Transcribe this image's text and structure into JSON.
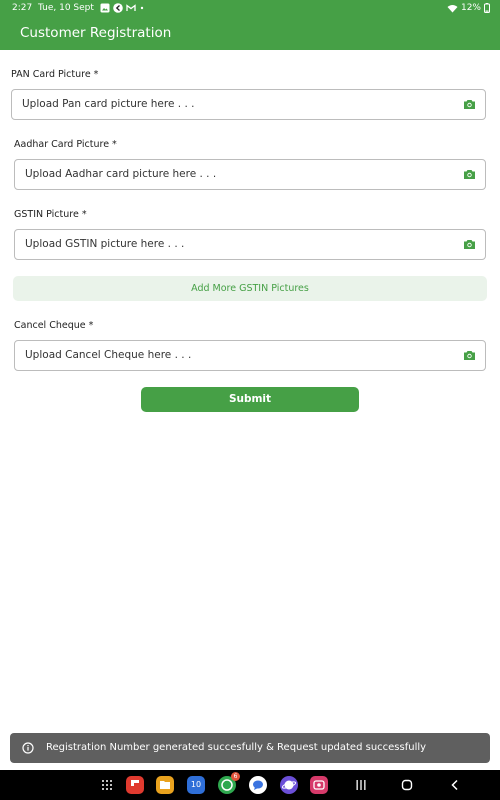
{
  "status_bar": {
    "time": "2:27",
    "date": "Tue, 10 Sept",
    "battery": "12%",
    "icons": [
      "gallery-icon",
      "app-icon",
      "gmail-icon",
      "dot-icon",
      "wifi-icon",
      "battery-icon"
    ]
  },
  "app_bar": {
    "title": "Customer Registration",
    "background": "#46a046"
  },
  "form": {
    "pan": {
      "label": "PAN Card Picture *",
      "placeholder": "Upload Pan card picture here . . ."
    },
    "aadhar": {
      "label": "Aadhar Card Picture *",
      "placeholder": "Upload Aadhar card picture here . . ."
    },
    "gstin": {
      "label": "GSTIN Picture *",
      "placeholder": "Upload GSTIN picture here . . ."
    },
    "add_more_gstin": "Add More GSTIN Pictures",
    "cheque": {
      "label": "Cancel Cheque *",
      "placeholder": "Upload Cancel Cheque here . . ."
    },
    "submit": "Submit"
  },
  "snackbar": {
    "message": "Registration Number generated succesfully & Request updated successfully",
    "icon": "info-icon"
  },
  "nav_bar": {
    "dock_icons": [
      "apps-grid-icon",
      "flipboard-icon",
      "files-icon",
      "calendar-icon",
      "business-chat-icon",
      "messages-icon",
      "internet-icon",
      "screen-recorder-icon"
    ],
    "calendar_day": "10",
    "badge_count": "6",
    "buttons": [
      "recents-button",
      "home-button",
      "back-button"
    ]
  }
}
